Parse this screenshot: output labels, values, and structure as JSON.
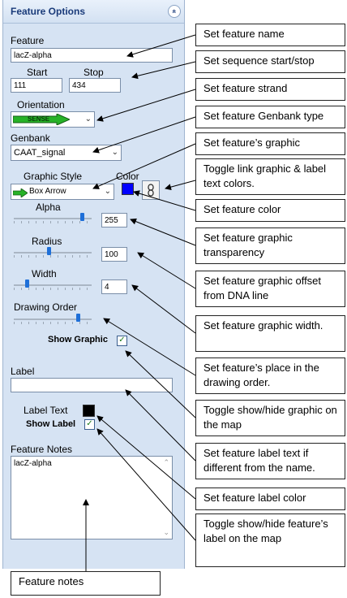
{
  "panel": {
    "title": "Feature Options",
    "collapse_glyph": "»",
    "feature_label": "Feature",
    "feature_name": "lacZ-alpha",
    "start_label": "Start",
    "stop_label": "Stop",
    "start_value": "111",
    "stop_value": "434",
    "orientation_label": "Orientation",
    "orientation_text": "SENSE",
    "genbank_label": "Genbank",
    "genbank_value": "CAAT_signal",
    "graphic_style_label": "Graphic Style",
    "graphic_style_value": "Box Arrow",
    "color_label": "Color",
    "feature_color": "#0000ff",
    "alpha_label": "Alpha",
    "alpha_value": "255",
    "alpha_level": 0.9,
    "radius_label": "Radius",
    "radius_value": "100",
    "radius_level": 0.45,
    "width_label": "Width",
    "width_value": "4",
    "width_level": 0.15,
    "drawing_order_label": "Drawing Order",
    "drawing_order_level": 0.85,
    "show_graphic_label": "Show Graphic",
    "show_graphic_checked": true,
    "label_label": "Label",
    "label_value": "",
    "label_text_label": "Label Text",
    "label_text_color": "#000000",
    "show_label_label": "Show Label",
    "show_label_checked": true,
    "notes_label": "Feature Notes",
    "notes_value": "lacZ-alpha"
  },
  "callouts": [
    "Set feature name",
    "Set sequence start/stop",
    "Set feature strand",
    "Set feature Genbank type",
    "Set feature’s graphic",
    "Toggle link graphic & label text colors.",
    "Set feature color",
    "Set feature graphic transparency",
    "Set feature graphic offset from DNA line",
    "Set feature graphic width.",
    "Set feature’s place in the drawing order.",
    "Toggle show/hide graphic on the map",
    "Set feature label text if different from the name.",
    "Set feature label color",
    "Toggle show/hide feature’s label on the map",
    "Feature notes"
  ]
}
